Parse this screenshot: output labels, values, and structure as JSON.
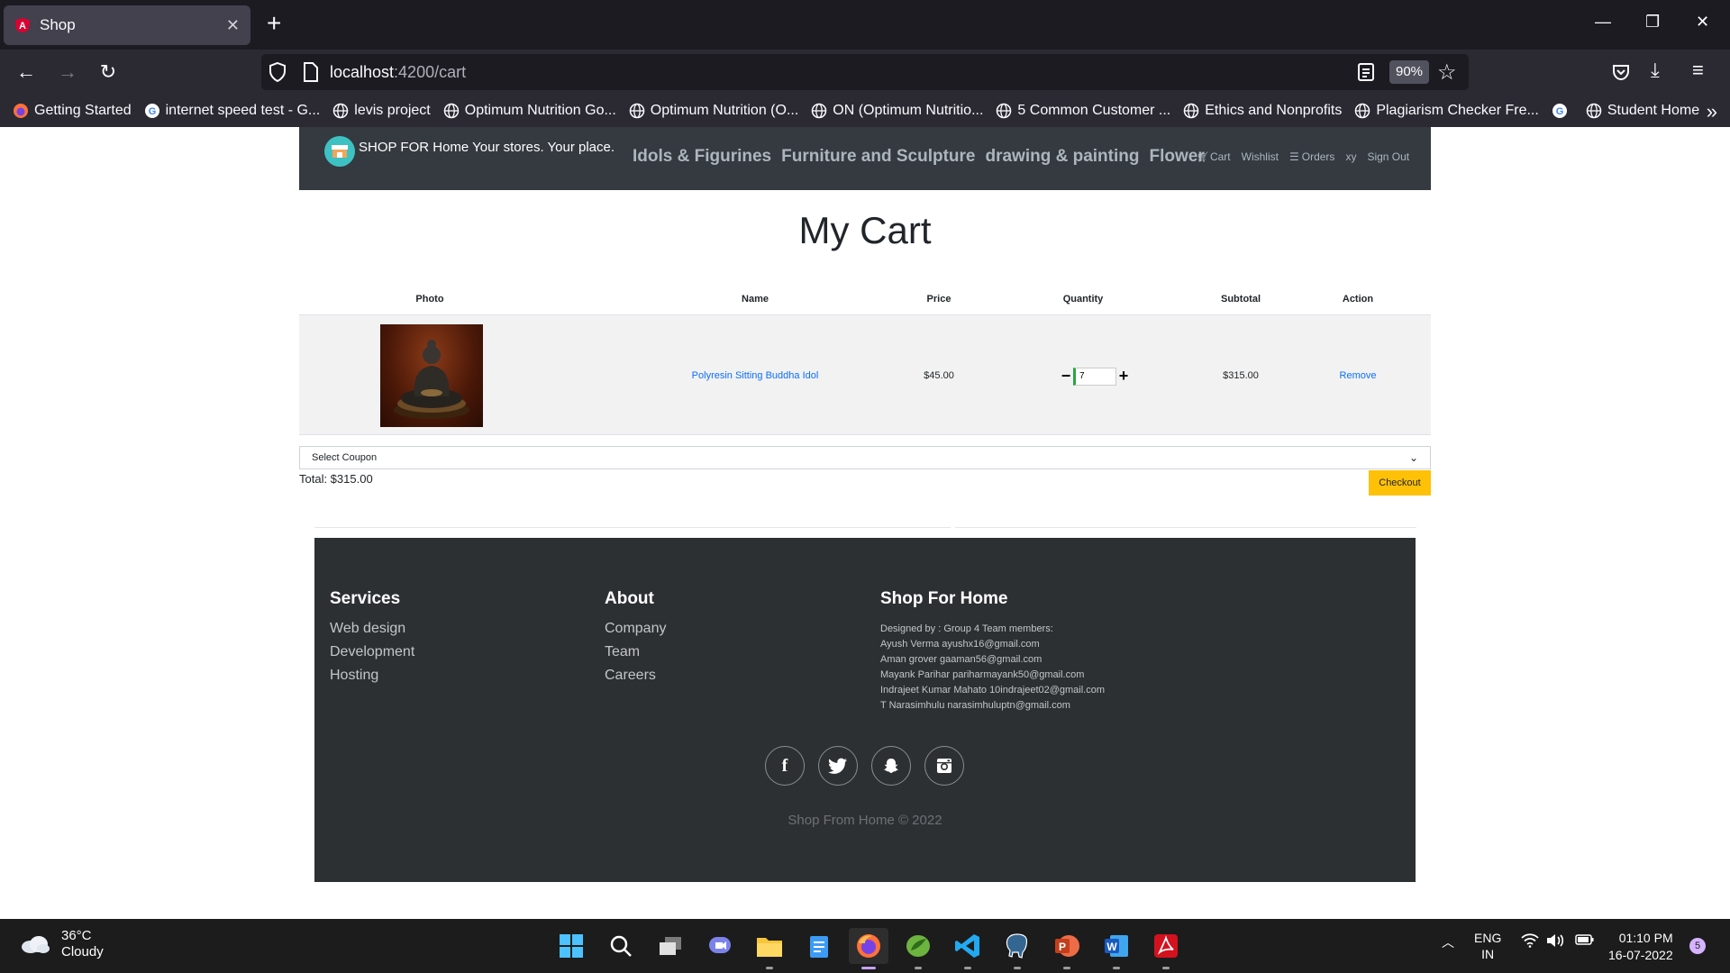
{
  "browser": {
    "tab_title": "Shop",
    "tab_close": "✕",
    "new_tab": "+",
    "url_host": "localhost",
    "url_path": ":4200/cart",
    "zoom": "90%",
    "bookmarks": [
      "Getting Started",
      "internet speed test - G...",
      "levis project",
      "Optimum Nutrition Go...",
      "Optimum Nutrition (O...",
      "ON (Optimum Nutritio...",
      "5 Common Customer ...",
      "Ethics and Nonprofits",
      "Plagiarism Checker Fre...",
      "",
      "Student Home"
    ]
  },
  "site": {
    "brand": "SHOP FOR Home Your stores. Your place.",
    "categories": [
      "Idols & Figurines",
      "Furniture and Sculpture",
      "drawing & painting",
      "Flower"
    ],
    "right_links": {
      "cart": "Cart",
      "wishlist": "Wishlist",
      "orders": "Orders",
      "user": "xy",
      "signout": "Sign Out"
    }
  },
  "cart": {
    "title": "My Cart",
    "headers": [
      "Photo",
      "Name",
      "Price",
      "Quantity",
      "Subtotal",
      "Action"
    ],
    "items": [
      {
        "name": "Polyresin Sitting Buddha Idol",
        "price": "$45.00",
        "quantity": "7",
        "subtotal": "$315.00",
        "action": "Remove"
      }
    ],
    "coupon_placeholder": "Select Coupon",
    "total": "Total: $315.00",
    "checkout": "Checkout"
  },
  "footer": {
    "services": {
      "heading": "Services",
      "links": [
        "Web design",
        "Development",
        "Hosting"
      ]
    },
    "about": {
      "heading": "About",
      "links": [
        "Company",
        "Team",
        "Careers"
      ]
    },
    "shop": {
      "heading": "Shop For Home",
      "lines": [
        "Designed by : Group 4 Team members:",
        "Ayush Verma ayushx16@gmail.com",
        "Aman grover gaaman56@gmail.com",
        "Mayank Parihar pariharmayank50@gmail.com",
        "Indrajeet Kumar Mahato 10indrajeet02@gmail.com",
        "T Narasimhulu narasimhuluptn@gmail.com"
      ]
    },
    "copyright": "Shop From Home © 2022"
  },
  "taskbar": {
    "temp": "36°C",
    "weather": "Cloudy",
    "lang1": "ENG",
    "lang2": "IN",
    "time": "01:10 PM",
    "date": "16-07-2022",
    "notifications": "5"
  },
  "colors": {
    "accent_blue": "#0d6efd",
    "checkout_yellow": "#ffc107",
    "navbar_dark": "#343a40",
    "footer_dark": "#2d3033"
  }
}
